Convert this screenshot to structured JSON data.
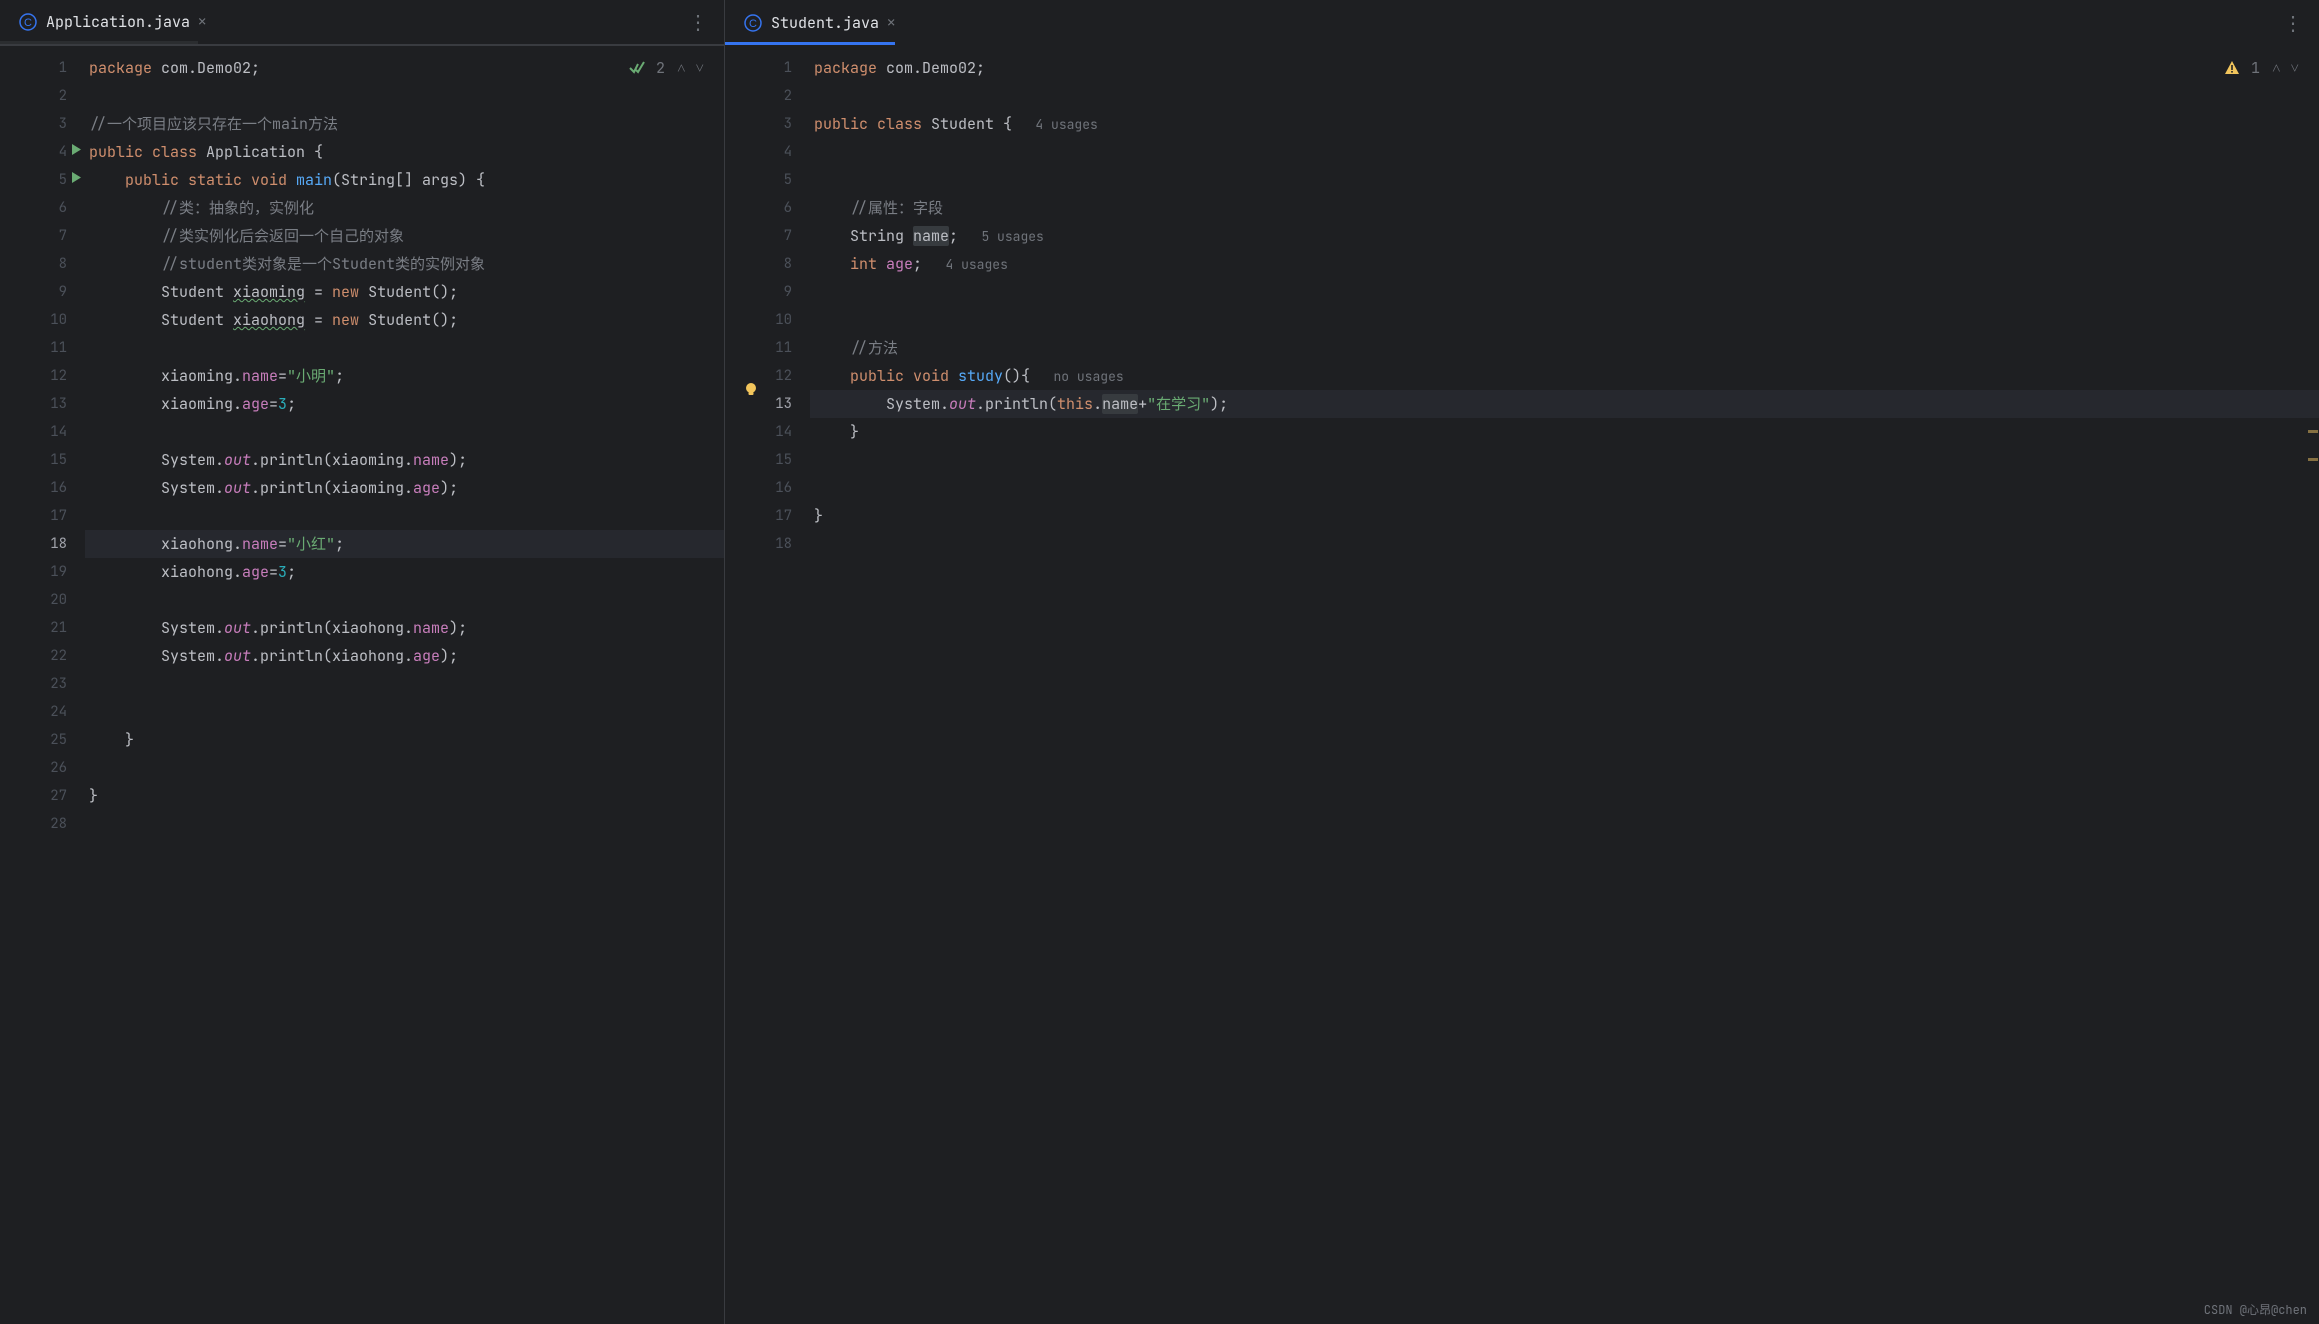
{
  "watermark": "CSDN @心昂@chen",
  "left": {
    "tab": {
      "filename": "Application.java",
      "underline_color": "#2b2d30",
      "underline_width": 198
    },
    "inspection": {
      "icon_color": "#6aab73",
      "count": "2"
    },
    "current_line": 18,
    "lines": 28,
    "code": [
      {
        "n": 1,
        "t": [
          [
            "kw",
            "package "
          ],
          [
            "ident",
            "com.Demo02;"
          ]
        ]
      },
      {
        "n": 2,
        "t": []
      },
      {
        "n": 3,
        "t": [
          [
            "comment",
            "//一个项目应该只存在一个main方法"
          ]
        ]
      },
      {
        "n": 4,
        "run": true,
        "t": [
          [
            "kw",
            "public class "
          ],
          [
            "ident",
            "Application {"
          ]
        ]
      },
      {
        "n": 5,
        "run": true,
        "t": [
          [
            "ident",
            "    "
          ],
          [
            "kw",
            "public static void "
          ],
          [
            "fn",
            "main"
          ],
          [
            "ident",
            "(String[] args) {"
          ]
        ]
      },
      {
        "n": 6,
        "t": [
          [
            "ident",
            "        "
          ],
          [
            "comment",
            "//类：抽象的，实例化"
          ]
        ]
      },
      {
        "n": 7,
        "t": [
          [
            "ident",
            "        "
          ],
          [
            "comment",
            "//类实例化后会返回一个自己的对象"
          ]
        ]
      },
      {
        "n": 8,
        "t": [
          [
            "ident",
            "        "
          ],
          [
            "comment",
            "//student类对象是一个Student类的实例对象"
          ]
        ]
      },
      {
        "n": 9,
        "t": [
          [
            "ident",
            "        Student "
          ],
          [
            "wavy",
            "xiaoming"
          ],
          [
            "ident",
            " = "
          ],
          [
            "kw",
            "new "
          ],
          [
            "ident",
            "Student();"
          ]
        ]
      },
      {
        "n": 10,
        "t": [
          [
            "ident",
            "        Student "
          ],
          [
            "wavy",
            "xiaohong"
          ],
          [
            "ident",
            " = "
          ],
          [
            "kw",
            "new "
          ],
          [
            "ident",
            "Student();"
          ]
        ]
      },
      {
        "n": 11,
        "t": []
      },
      {
        "n": 12,
        "t": [
          [
            "ident",
            "        xiaoming."
          ],
          [
            "field",
            "name"
          ],
          [
            "ident",
            "="
          ],
          [
            "str",
            "\"小明\""
          ],
          [
            "ident",
            ";"
          ]
        ]
      },
      {
        "n": 13,
        "t": [
          [
            "ident",
            "        xiaoming."
          ],
          [
            "field",
            "age"
          ],
          [
            "ident",
            "="
          ],
          [
            "num",
            "3"
          ],
          [
            "ident",
            ";"
          ]
        ]
      },
      {
        "n": 14,
        "t": []
      },
      {
        "n": 15,
        "t": [
          [
            "ident",
            "        System."
          ],
          [
            "static-ital",
            "out"
          ],
          [
            "ident",
            ".println(xiaoming."
          ],
          [
            "field",
            "name"
          ],
          [
            "ident",
            ");"
          ]
        ]
      },
      {
        "n": 16,
        "t": [
          [
            "ident",
            "        System."
          ],
          [
            "static-ital",
            "out"
          ],
          [
            "ident",
            ".println(xiaoming."
          ],
          [
            "field",
            "age"
          ],
          [
            "ident",
            ");"
          ]
        ]
      },
      {
        "n": 17,
        "t": []
      },
      {
        "n": 18,
        "current": true,
        "t": [
          [
            "ident",
            "        xiaohong."
          ],
          [
            "field",
            "name"
          ],
          [
            "ident",
            "="
          ],
          [
            "str",
            "\"小红\""
          ],
          [
            "ident",
            ";"
          ]
        ]
      },
      {
        "n": 19,
        "t": [
          [
            "ident",
            "        xiaohong."
          ],
          [
            "field",
            "age"
          ],
          [
            "ident",
            "="
          ],
          [
            "num",
            "3"
          ],
          [
            "ident",
            ";"
          ]
        ]
      },
      {
        "n": 20,
        "t": []
      },
      {
        "n": 21,
        "t": [
          [
            "ident",
            "        System."
          ],
          [
            "static-ital",
            "out"
          ],
          [
            "ident",
            ".println(xiaohong."
          ],
          [
            "field",
            "name"
          ],
          [
            "ident",
            ");"
          ]
        ]
      },
      {
        "n": 22,
        "t": [
          [
            "ident",
            "        System."
          ],
          [
            "static-ital",
            "out"
          ],
          [
            "ident",
            ".println(xiaohong."
          ],
          [
            "field",
            "age"
          ],
          [
            "ident",
            ");"
          ]
        ]
      },
      {
        "n": 23,
        "t": []
      },
      {
        "n": 24,
        "t": []
      },
      {
        "n": 25,
        "t": [
          [
            "ident",
            "    }"
          ]
        ]
      },
      {
        "n": 26,
        "t": []
      },
      {
        "n": 27,
        "t": [
          [
            "ident",
            "}"
          ]
        ]
      },
      {
        "n": 28,
        "t": []
      }
    ]
  },
  "right": {
    "tab": {
      "filename": "Student.java",
      "underline_color": "#3574f0",
      "underline_width": 170
    },
    "inspection": {
      "icon_color": "#f2c55c",
      "count": "1"
    },
    "current_line": 13,
    "lines": 18,
    "markers": [
      384,
      412
    ],
    "code": [
      {
        "n": 1,
        "t": [
          [
            "kw",
            "package "
          ],
          [
            "ident",
            "com.Demo02;"
          ]
        ]
      },
      {
        "n": 2,
        "t": []
      },
      {
        "n": 3,
        "t": [
          [
            "kw",
            "public class "
          ],
          [
            "ident",
            "Student {"
          ]
        ],
        "usage": "4 usages"
      },
      {
        "n": 4,
        "t": []
      },
      {
        "n": 5,
        "t": []
      },
      {
        "n": 6,
        "t": [
          [
            "ident",
            "    "
          ],
          [
            "comment",
            "//属性：字段"
          ]
        ]
      },
      {
        "n": 7,
        "t": [
          [
            "ident",
            "    String "
          ],
          [
            "boxed",
            "name"
          ],
          [
            "ident",
            ";"
          ]
        ],
        "usage": "5 usages"
      },
      {
        "n": 8,
        "t": [
          [
            "ident",
            "    "
          ],
          [
            "kw",
            "int "
          ],
          [
            "field",
            "age"
          ],
          [
            "ident",
            ";"
          ]
        ],
        "usage": "4 usages"
      },
      {
        "n": 9,
        "t": []
      },
      {
        "n": 10,
        "t": []
      },
      {
        "n": 11,
        "t": [
          [
            "ident",
            "    "
          ],
          [
            "comment",
            "//方法"
          ]
        ]
      },
      {
        "n": 12,
        "t": [
          [
            "ident",
            "    "
          ],
          [
            "kw",
            "public void "
          ],
          [
            "fn",
            "study"
          ],
          [
            "ident",
            "(){"
          ]
        ],
        "usage": "no usages"
      },
      {
        "n": 13,
        "current": true,
        "bulb": true,
        "t": [
          [
            "ident",
            "        System."
          ],
          [
            "static-ital",
            "out"
          ],
          [
            "ident",
            ".println("
          ],
          [
            "this-kw",
            "this"
          ],
          [
            "ident",
            "."
          ],
          [
            "boxed",
            "name"
          ],
          [
            "ident",
            "+"
          ],
          [
            "str",
            "\"在学习\""
          ],
          [
            "ident",
            ");"
          ]
        ]
      },
      {
        "n": 14,
        "t": [
          [
            "ident",
            "    }"
          ]
        ]
      },
      {
        "n": 15,
        "t": []
      },
      {
        "n": 16,
        "t": []
      },
      {
        "n": 17,
        "t": [
          [
            "ident",
            "}"
          ]
        ]
      },
      {
        "n": 18,
        "t": []
      }
    ]
  }
}
